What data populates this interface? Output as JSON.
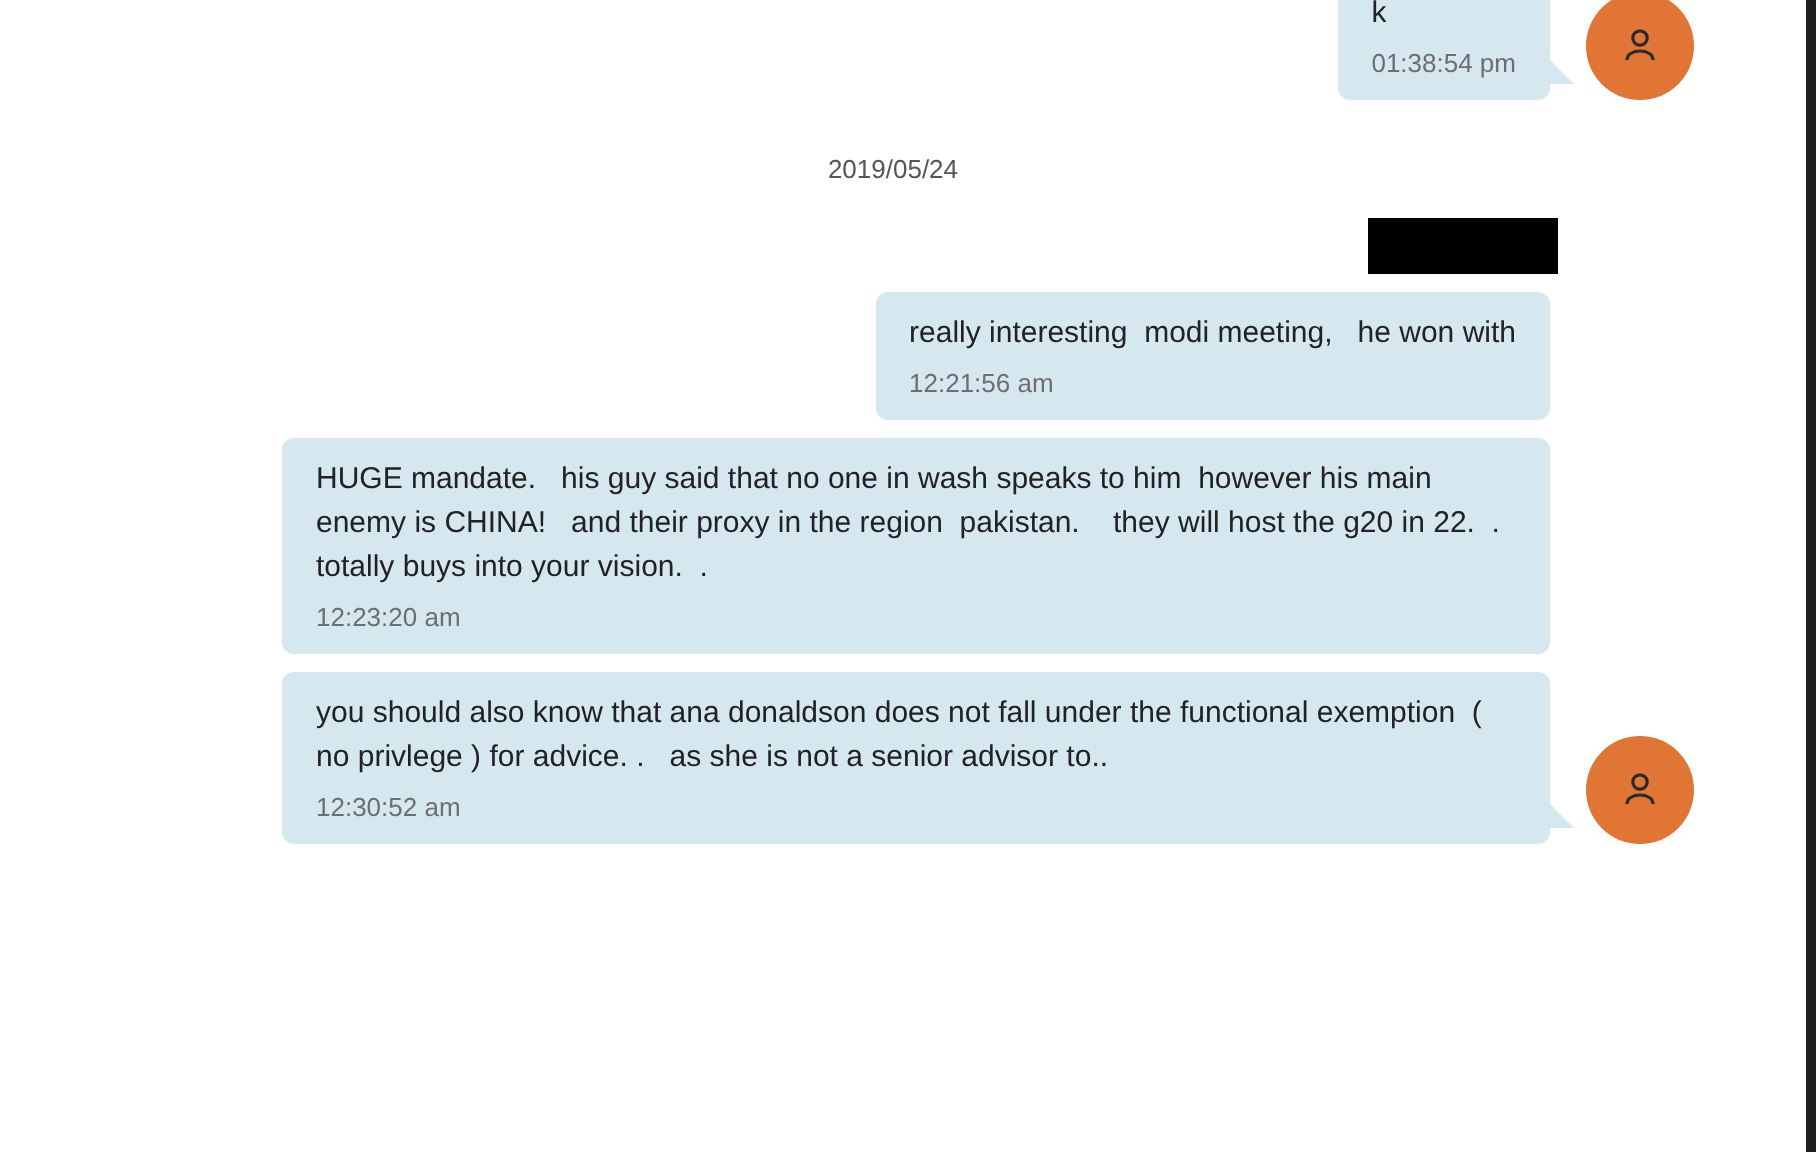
{
  "thread": [
    {
      "kind": "message",
      "text": "k",
      "time": "01:38:54 pm",
      "avatar": true
    },
    {
      "kind": "date",
      "text": "2019/05/24"
    },
    {
      "kind": "redacted"
    },
    {
      "kind": "message",
      "text": "really interesting  modi meeting,   he won with",
      "time": "12:21:56 am",
      "avatar": false
    },
    {
      "kind": "message",
      "text": "HUGE mandate.   his guy said that no one in wash speaks to him  however his main enemy is CHINA!   and their proxy in the region  pakistan.    they will host the g20 in 22.  .  totally buys into your vision.  .",
      "time": "12:23:20 am",
      "avatar": false
    },
    {
      "kind": "message",
      "text": "you should also know that ana donaldson does not fall under the functional exemption  ( no privlege ) for advice. .   as she is not a senior advisor to..",
      "time": "12:30:52 am",
      "avatar": true
    }
  ]
}
